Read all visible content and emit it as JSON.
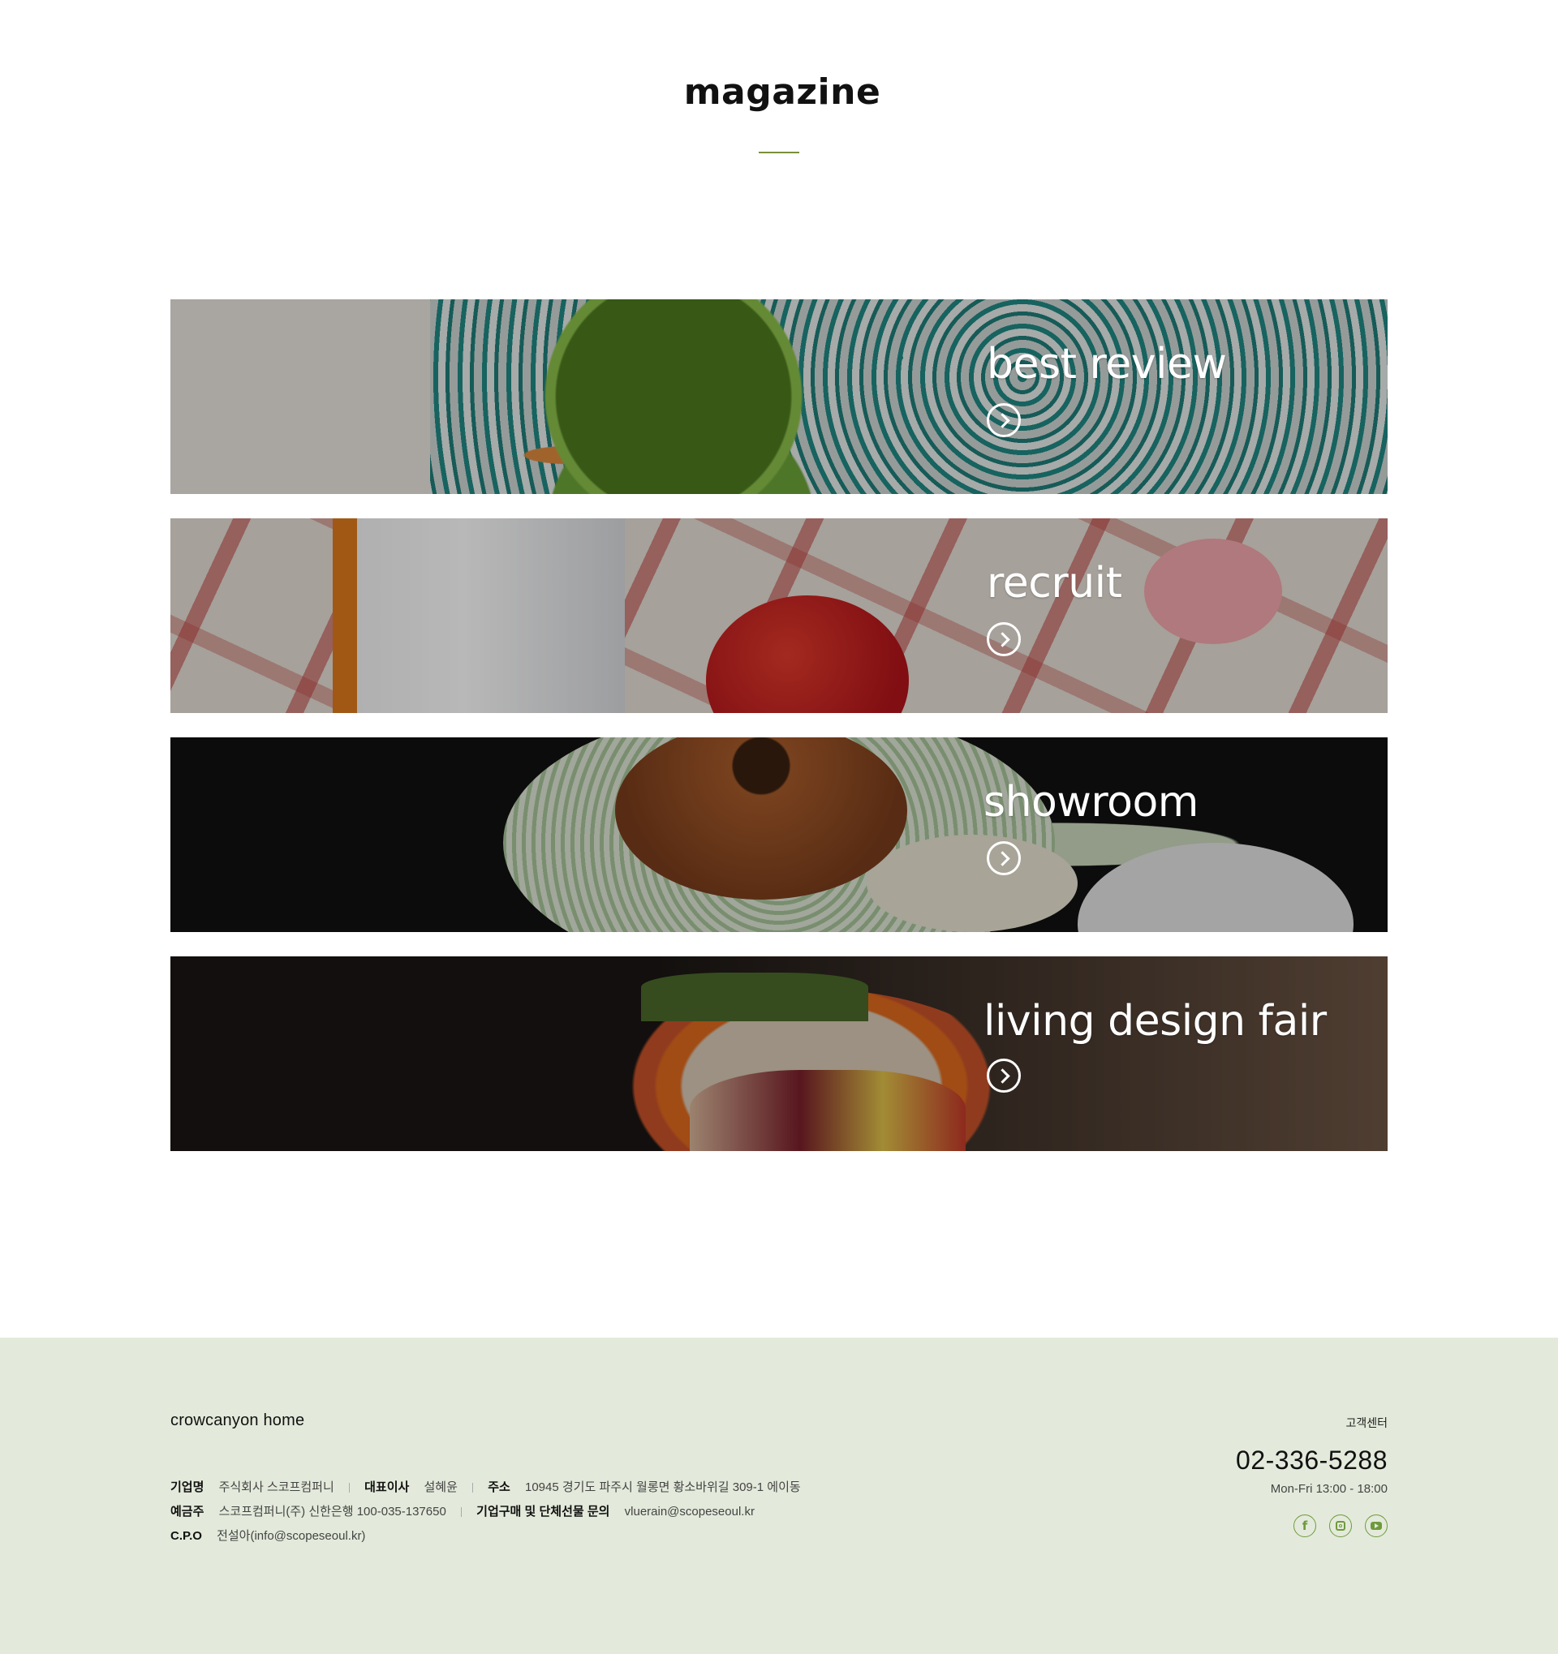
{
  "page": {
    "title": "magazine",
    "accent_color": "#7a8f3d"
  },
  "banners": [
    {
      "label": "best review",
      "icon": "arrow-right-circle-icon"
    },
    {
      "label": "recruit",
      "icon": "arrow-right-circle-icon"
    },
    {
      "label": "showroom",
      "icon": "arrow-right-circle-icon"
    },
    {
      "label": "living design fair",
      "icon": "arrow-right-circle-icon"
    }
  ],
  "footer": {
    "background": "#e3eadb",
    "brand": "crowcanyon home",
    "company": {
      "name_key": "기업명",
      "name_value": "주식회사 스코프컴퍼니",
      "ceo_key": "대표이사",
      "ceo_value": "설혜윤",
      "address_key": "주소",
      "address_value": "10945 경기도 파주시 월롱면 황소바위길 309-1 에이동",
      "account_key": "예금주",
      "account_value": "스코프컴퍼니(주) 신한은행 100-035-137650",
      "inquiry_key": "기업구매 및 단체선물 문의",
      "inquiry_value": "vluerain@scopeseoul.kr",
      "cpo_key": "C.P.O",
      "cpo_value": "전설아(info@scopeseoul.kr)"
    },
    "customer_center": {
      "label": "고객센터",
      "phone": "02-336-5288",
      "hours": "Mon-Fri 13:00 - 18:00"
    },
    "social": [
      {
        "name": "facebook-icon",
        "glyph": "f"
      },
      {
        "name": "instagram-icon"
      },
      {
        "name": "youtube-icon"
      }
    ],
    "social_color": "#6f9a3c"
  }
}
